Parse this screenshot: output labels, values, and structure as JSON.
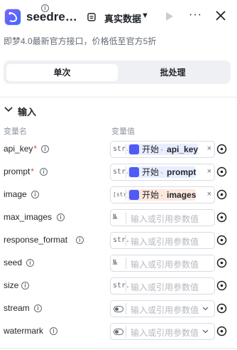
{
  "header": {
    "title": "seedrea…",
    "mode_label": "真实数据",
    "more_label": "···"
  },
  "description": "即梦4.0最新官方接口，价格低至官方5折",
  "tabs": [
    {
      "label": "单次",
      "active": true
    },
    {
      "label": "批处理",
      "active": false
    }
  ],
  "section": {
    "title": "输入",
    "col_name": "变量名",
    "col_value": "变量值"
  },
  "params": [
    {
      "name": "api_key",
      "required": true,
      "type_tag": "str.",
      "ref": {
        "source": "开始",
        "var": "api_key"
      }
    },
    {
      "name": "prompt",
      "required": true,
      "type_tag": "str.",
      "ref": {
        "source": "开始",
        "var": "prompt"
      }
    },
    {
      "name": "image",
      "required": false,
      "type_tag": "[str]",
      "ref": {
        "source": "开始",
        "var": "images"
      }
    },
    {
      "name": "max_images",
      "required": false,
      "type_tag": "№",
      "placeholder": "输入或引用参数值"
    },
    {
      "name": "response_format",
      "required": false,
      "type_tag": "str.",
      "placeholder": "输入或引用参数值"
    },
    {
      "name": "seed",
      "required": false,
      "type_tag": "№",
      "placeholder": "输入或引用参数值"
    },
    {
      "name": "size",
      "required": false,
      "type_tag": "str.",
      "placeholder": "输入或引用参数值"
    },
    {
      "name": "stream",
      "required": false,
      "type_tag": "toggle",
      "placeholder": "输入或引用参数值"
    },
    {
      "name": "watermark",
      "required": false,
      "type_tag": "toggle",
      "placeholder": "输入或引用参数值"
    }
  ],
  "colors": {
    "accent": "#4e5bf5",
    "ref_chip_bg": "#e8edff",
    "image_chip_bg": "#fde7dd",
    "required": "#e5484d",
    "tab_bg": "#eef0f4"
  },
  "icons": {
    "logo": "app-logo-icon",
    "mode": "database-icon",
    "run": "play-icon",
    "more": "more-icon",
    "close": "close-icon",
    "info": "info-icon",
    "target": "target-icon"
  }
}
